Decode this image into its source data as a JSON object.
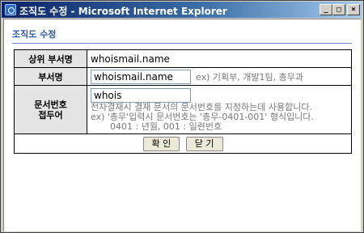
{
  "window": {
    "title": "조직도 수정 - Microsoft Internet Explorer",
    "min_glyph": "_",
    "max_glyph": "□",
    "close_glyph": "×"
  },
  "page": {
    "heading": "조직도 수정"
  },
  "form": {
    "parent_label": "상위 부서명",
    "parent_value": "whoismail.name",
    "dept_label": "부서명",
    "dept_value": "whoismail.name",
    "dept_hint": "ex) 기획부, 개발1팀, 총무과",
    "prefix_label_line1": "문서번호",
    "prefix_label_line2": "접두어",
    "prefix_value": "whois",
    "help_line1": "전자결재시 결재 문서의 문서번호를 지정하는데 사용합니다.",
    "help_line2": "ex) '총무'입력시 문서번호는 '총무-0401-001' 형식입니다.",
    "help_line3": "0401 : 년월, 001 : 일련번호"
  },
  "buttons": {
    "confirm": "확 인",
    "close": "닫 기"
  }
}
